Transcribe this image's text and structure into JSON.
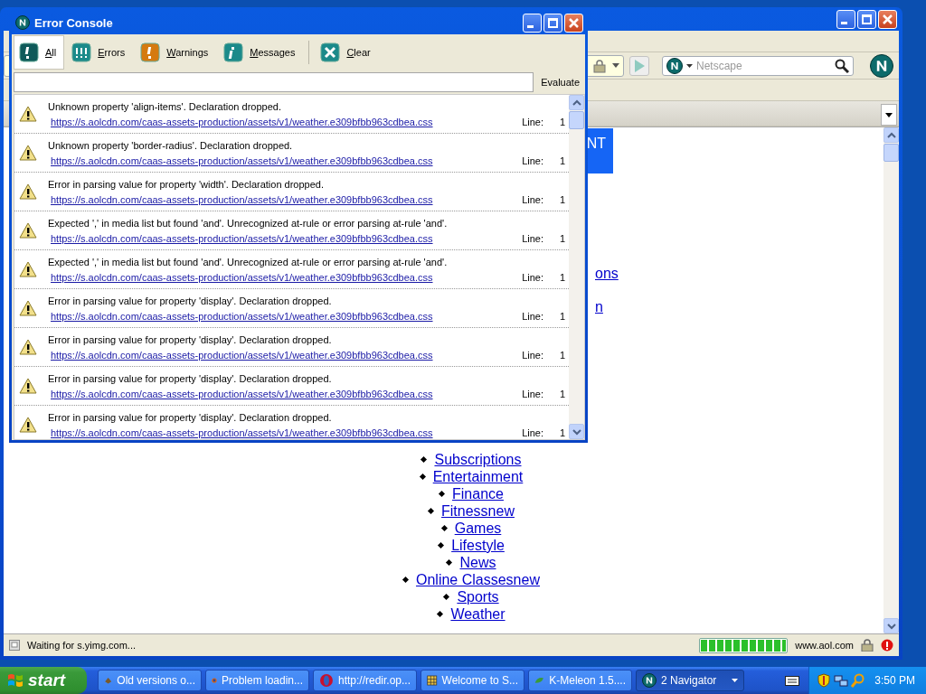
{
  "browser": {
    "search": {
      "placeholder": "Netscape"
    },
    "content": {
      "banner_text": "NT",
      "partial_links": [
        "ons",
        "n"
      ],
      "links": [
        "Subscriptions",
        "Entertainment",
        "Finance",
        "Fitnessnew",
        "Games",
        "Lifestyle",
        "News",
        "Online Classesnew",
        "Sports",
        "Weather"
      ]
    },
    "status_bar": {
      "text": "Waiting for s.yimg.com...",
      "progress": {
        "level": 1
      },
      "site": "www.aol.com"
    }
  },
  "console": {
    "title": "Error Console",
    "tabs": [
      {
        "kind": "all",
        "label": "All",
        "selected": true
      },
      {
        "kind": "errors",
        "label": "Errors",
        "selected": false
      },
      {
        "kind": "warnings",
        "label": "Warnings",
        "selected": false
      },
      {
        "kind": "messages",
        "label": "Messages",
        "selected": false
      }
    ],
    "clear": "Clear",
    "evaluate": "Evaluate",
    "messages": [
      {
        "kind": "warning",
        "text": "Unknown property 'align-items'.  Declaration dropped.",
        "url": "https://s.aolcdn.com/caas-assets-production/assets/v1/weather.e309bfbb963cdbea.css",
        "line_label": "Line:",
        "line": "1"
      },
      {
        "kind": "warning",
        "text": "Unknown property 'border-radius'.  Declaration dropped.",
        "url": "https://s.aolcdn.com/caas-assets-production/assets/v1/weather.e309bfbb963cdbea.css",
        "line_label": "Line:",
        "line": "1"
      },
      {
        "kind": "warning",
        "text": "Error in parsing value for property 'width'.  Declaration dropped.",
        "url": "https://s.aolcdn.com/caas-assets-production/assets/v1/weather.e309bfbb963cdbea.css",
        "line_label": "Line:",
        "line": "1"
      },
      {
        "kind": "warning",
        "text": "Expected ',' in media list but found 'and'.  Unrecognized at-rule or error parsing at-rule 'and'.",
        "url": "https://s.aolcdn.com/caas-assets-production/assets/v1/weather.e309bfbb963cdbea.css",
        "line_label": "Line:",
        "line": "1"
      },
      {
        "kind": "warning",
        "text": "Expected ',' in media list but found 'and'.  Unrecognized at-rule or error parsing at-rule 'and'.",
        "url": "https://s.aolcdn.com/caas-assets-production/assets/v1/weather.e309bfbb963cdbea.css",
        "line_label": "Line:",
        "line": "1"
      },
      {
        "kind": "warning",
        "text": "Error in parsing value for property 'display'.  Declaration dropped.",
        "url": "https://s.aolcdn.com/caas-assets-production/assets/v1/weather.e309bfbb963cdbea.css",
        "line_label": "Line:",
        "line": "1"
      },
      {
        "kind": "warning",
        "text": "Error in parsing value for property 'display'.  Declaration dropped.",
        "url": "https://s.aolcdn.com/caas-assets-production/assets/v1/weather.e309bfbb963cdbea.css",
        "line_label": "Line:",
        "line": "1"
      },
      {
        "kind": "warning",
        "text": "Error in parsing value for property 'display'.  Declaration dropped.",
        "url": "https://s.aolcdn.com/caas-assets-production/assets/v1/weather.e309bfbb963cdbea.css",
        "line_label": "Line:",
        "line": "1"
      },
      {
        "kind": "warning",
        "text": "Error in parsing value for property 'display'.  Declaration dropped.",
        "url": "https://s.aolcdn.com/caas-assets-production/assets/v1/weather.e309bfbb963cdbea.css",
        "line_label": "Line:",
        "line": "1"
      }
    ]
  },
  "taskbar": {
    "start": "start",
    "tasks": [
      {
        "label": "Old versions o...",
        "selected": false,
        "grouped": false
      },
      {
        "label": "Problem loadin...",
        "selected": false,
        "grouped": false
      },
      {
        "label": "http://redir.op...",
        "selected": false,
        "grouped": false
      },
      {
        "label": "Welcome to S...",
        "selected": false,
        "grouped": false
      },
      {
        "label": "K-Meleon 1.5....",
        "selected": false,
        "grouped": false
      },
      {
        "label": "2 Navigator",
        "selected": true,
        "grouped": true
      }
    ],
    "clock": "3:50 PM"
  }
}
